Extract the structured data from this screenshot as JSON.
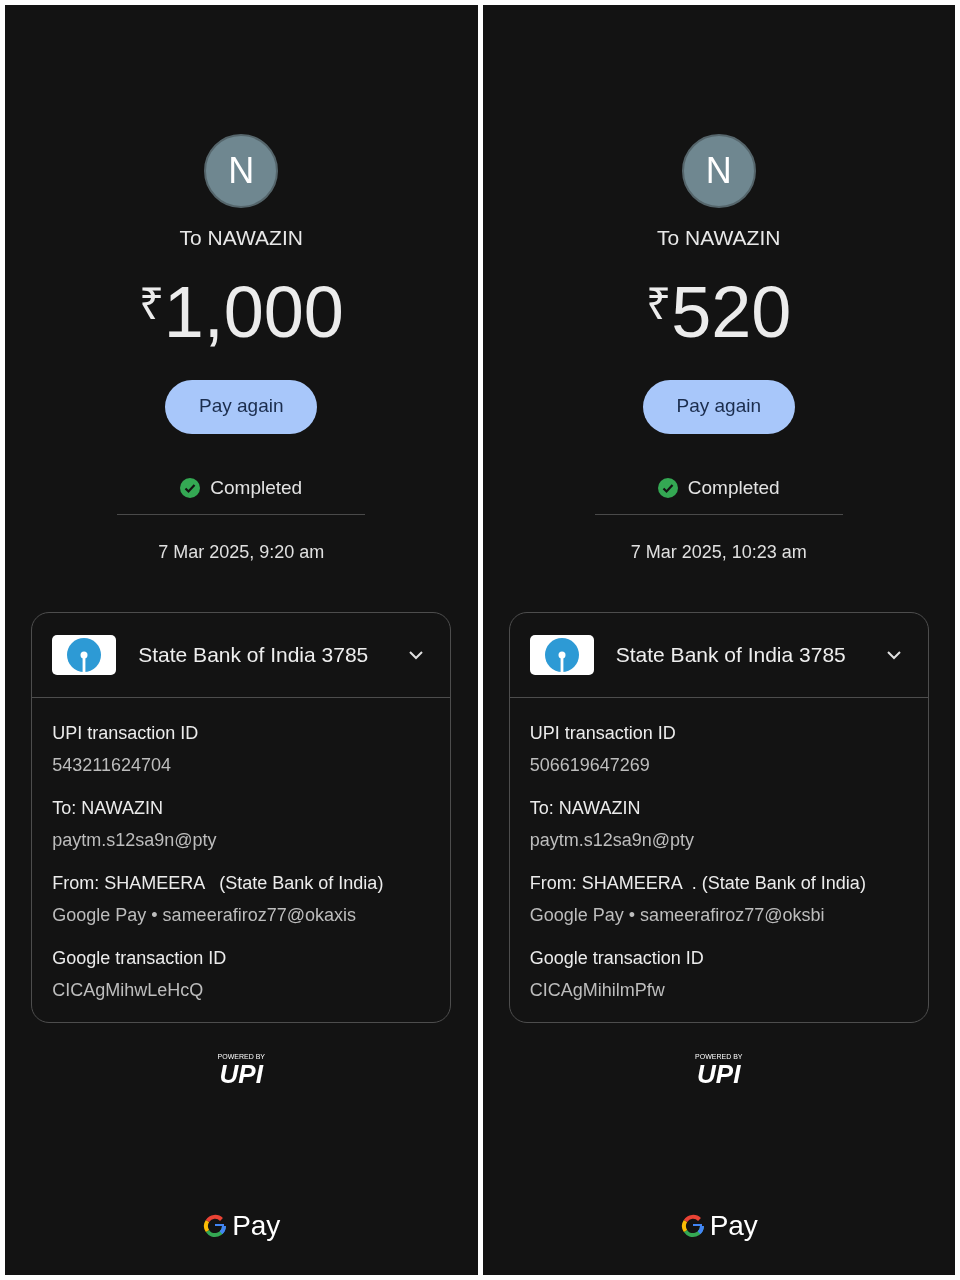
{
  "screens": [
    {
      "avatar_initial": "N",
      "recipient": "To NAWAZIN",
      "currency": "₹",
      "amount": "1,000",
      "pay_again": "Pay again",
      "status": "Completed",
      "datetime": "7 Mar 2025, 9:20 am",
      "bank": "State Bank of India 3785",
      "expanded": true,
      "details": [
        {
          "label": "UPI transaction ID",
          "value": "543211624704"
        },
        {
          "label": "To: NAWAZIN",
          "value": "paytm.s12sa9n@pty"
        },
        {
          "label": "From: SHAMEERA   (State Bank of India)",
          "value": "Google Pay • sameerafiroz77@okaxis"
        },
        {
          "label": "Google transaction ID",
          "value": "CICAgMihwLeHcQ"
        }
      ],
      "powered_by": "POWERED BY",
      "upi": "UPI",
      "brand": "Pay"
    },
    {
      "avatar_initial": "N",
      "recipient": "To NAWAZIN",
      "currency": "₹",
      "amount": "520",
      "pay_again": "Pay again",
      "status": "Completed",
      "datetime": "7 Mar 2025, 10:23 am",
      "bank": "State Bank of India 3785",
      "expanded": true,
      "details": [
        {
          "label": "UPI transaction ID",
          "value": "506619647269"
        },
        {
          "label": "To: NAWAZIN",
          "value": "paytm.s12sa9n@pty"
        },
        {
          "label": "From: SHAMEERA  . (State Bank of India)",
          "value": "Google Pay • sameerafiroz77@oksbi"
        },
        {
          "label": "Google transaction ID",
          "value": "CICAgMihilmPfw"
        }
      ],
      "powered_by": "POWERED BY",
      "upi": "UPI",
      "brand": "Pay"
    }
  ]
}
